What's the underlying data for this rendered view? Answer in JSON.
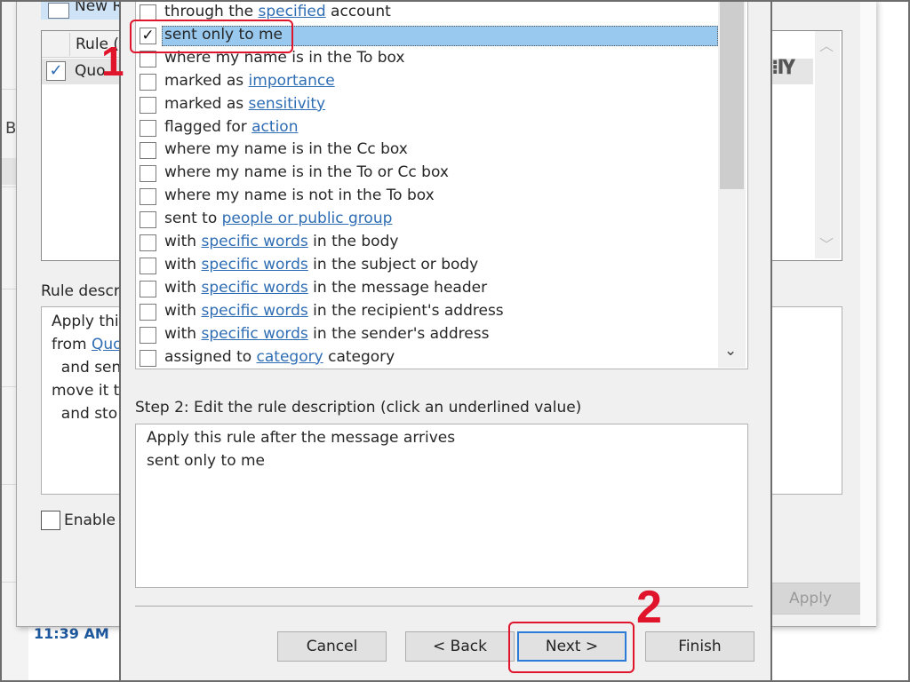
{
  "background": {
    "new_rule_label": "New R",
    "rule_column_header": "Rule (",
    "rule_row_name": "Quo",
    "rule_row_checked": true,
    "sidebar_letter": "B",
    "rule_description_label": "Rule descr",
    "rule_description_lines": [
      {
        "text": "Apply thi",
        "link": ""
      },
      {
        "text": "from ",
        "link": "Quo"
      },
      {
        "text": "  and sen",
        "link": ""
      },
      {
        "text": "move it t",
        "link": ""
      },
      {
        "text": "  and sto",
        "link": ""
      }
    ],
    "enable_label": "Enable",
    "apply_label": "Apply",
    "time": "11:39 AM"
  },
  "wizard": {
    "conditions": [
      {
        "pre": "through the ",
        "link": "specified",
        "post": " account",
        "checked": false,
        "selected": false
      },
      {
        "pre": "sent only to me",
        "link": "",
        "post": "",
        "checked": true,
        "selected": true
      },
      {
        "pre": "where my name is in the To box",
        "link": "",
        "post": "",
        "checked": false,
        "selected": false
      },
      {
        "pre": "marked as ",
        "link": "importance",
        "post": "",
        "checked": false,
        "selected": false
      },
      {
        "pre": "marked as ",
        "link": "sensitivity",
        "post": "",
        "checked": false,
        "selected": false
      },
      {
        "pre": "flagged for ",
        "link": "action",
        "post": "",
        "checked": false,
        "selected": false
      },
      {
        "pre": "where my name is in the Cc box",
        "link": "",
        "post": "",
        "checked": false,
        "selected": false
      },
      {
        "pre": "where my name is in the To or Cc box",
        "link": "",
        "post": "",
        "checked": false,
        "selected": false
      },
      {
        "pre": "where my name is not in the To box",
        "link": "",
        "post": "",
        "checked": false,
        "selected": false
      },
      {
        "pre": "sent to ",
        "link": "people or public group",
        "post": "",
        "checked": false,
        "selected": false
      },
      {
        "pre": "with ",
        "link": "specific words",
        "post": " in the body",
        "checked": false,
        "selected": false
      },
      {
        "pre": "with ",
        "link": "specific words",
        "post": " in the subject or body",
        "checked": false,
        "selected": false
      },
      {
        "pre": "with ",
        "link": "specific words",
        "post": " in the message header",
        "checked": false,
        "selected": false
      },
      {
        "pre": "with ",
        "link": "specific words",
        "post": " in the recipient's address",
        "checked": false,
        "selected": false
      },
      {
        "pre": "with ",
        "link": "specific words",
        "post": " in the sender's address",
        "checked": false,
        "selected": false
      },
      {
        "pre": "assigned to ",
        "link": "category",
        "post": " category",
        "checked": false,
        "selected": false
      }
    ],
    "step2_label": "Step 2: Edit the rule description (click an underlined value)",
    "step2_lines": [
      "Apply this rule after the message arrives",
      "sent only to me"
    ],
    "buttons": {
      "cancel": "Cancel",
      "back": "< Back",
      "next": "Next >",
      "finish": "Finish"
    }
  },
  "annotations": {
    "step1": "1",
    "step2": "2",
    "color": "#e0142b"
  }
}
